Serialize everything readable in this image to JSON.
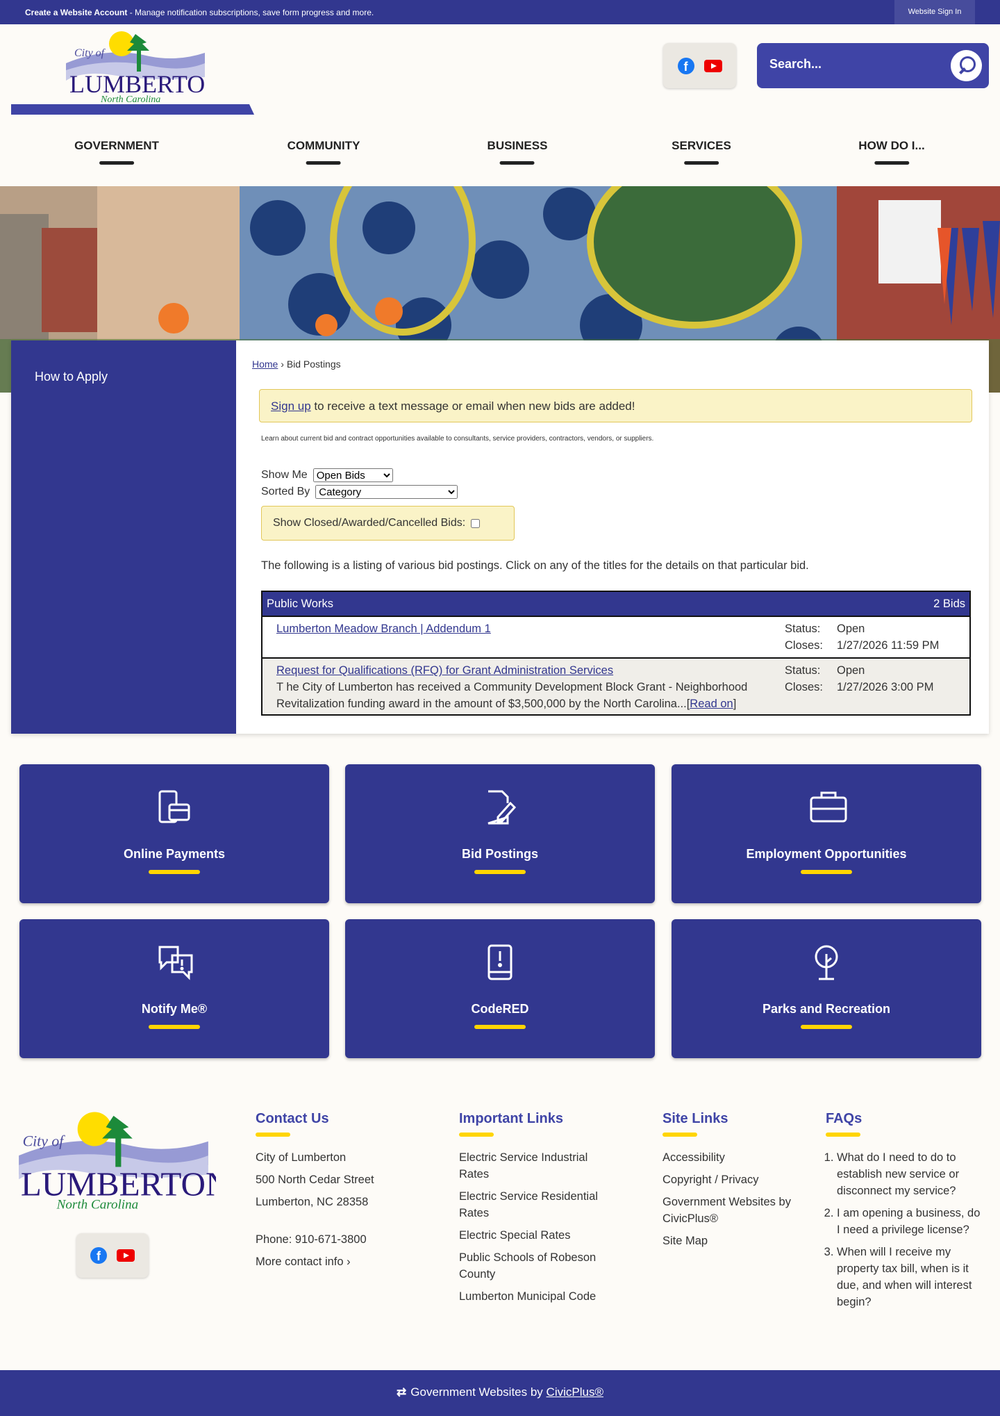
{
  "topbar": {
    "account_bold": "Create a Website Account",
    "account_text": " - Manage notification subscriptions, save form progress and more.",
    "sign_in": "Website Sign In"
  },
  "header": {
    "logo_text": "City of Lumberton North Carolina",
    "search_placeholder": "Search..."
  },
  "nav": [
    "GOVERNMENT",
    "COMMUNITY",
    "BUSINESS",
    "SERVICES",
    "HOW DO I..."
  ],
  "sidebar": {
    "items": [
      "How to Apply"
    ]
  },
  "breadcrumb": {
    "home": "Home",
    "sep": " › ",
    "current": "Bid Postings"
  },
  "alert": {
    "link": "Sign up",
    "text": " to receive a text message or email when new bids are added!"
  },
  "learn": "Learn about current bid and contract opportunities available to consultants, service providers, contractors, vendors, or suppliers.",
  "filters": {
    "show_me_label": "Show Me",
    "show_me_value": "Open Bids",
    "sorted_by_label": "Sorted By",
    "sorted_by_value": "Category",
    "closed_label": "Show Closed/Awarded/Cancelled Bids:"
  },
  "intro": "The following is a listing of various bid postings. Click on any of the titles for the details on that particular bid.",
  "bids": {
    "category": "Public Works",
    "count": "2 Bids",
    "status_label": "Status:",
    "closes_label": "Closes:",
    "rows": [
      {
        "title": "Lumberton Meadow Branch | Addendum 1",
        "desc": "",
        "status": "Open",
        "closes": "1/27/2026 11:59 PM"
      },
      {
        "title": "Request for Qualifications (RFQ) for Grant Administration Services",
        "desc": "T he City of Lumberton has received a Community Development Block Grant - Neighborhood Revitalization funding award in the amount of $3,500,000 by the North Carolina...",
        "read_on": "Read on",
        "status": "Open",
        "closes": "1/27/2026 3:00 PM"
      }
    ]
  },
  "tiles": [
    "Online Payments",
    "Bid Postings",
    "Employment Opportunities",
    "Notify Me®",
    "CodeRED",
    "Parks and Recreation"
  ],
  "footer": {
    "contact": {
      "title": "Contact Us",
      "name": "City of Lumberton",
      "street": "500 North Cedar Street",
      "city": "Lumberton, NC 28358",
      "phone": "Phone: 910-671-3800",
      "more": "More contact info ›"
    },
    "important": {
      "title": "Important Links",
      "links": [
        "Electric Service Industrial Rates",
        "Electric Service Residential Rates",
        "Electric Special Rates",
        "Public Schools of Robeson County",
        "Lumberton Municipal Code"
      ]
    },
    "site": {
      "title": "Site Links",
      "links": [
        "Accessibility",
        "Copyright / Privacy",
        "Government Websites by CivicPlus®",
        "Site Map"
      ]
    },
    "faqs": {
      "title": "FAQs",
      "items": [
        "What do I need to do to establish new service or disconnect my service?",
        "I am opening a business, do I need a privilege license?",
        "When will I receive my property tax bill, when is it due, and when will interest begin?"
      ]
    }
  },
  "bottom": {
    "text": "Government Websites by ",
    "link": "CivicPlus®"
  },
  "colors": {
    "brand": "#32378f",
    "accent": "#ffd500"
  }
}
